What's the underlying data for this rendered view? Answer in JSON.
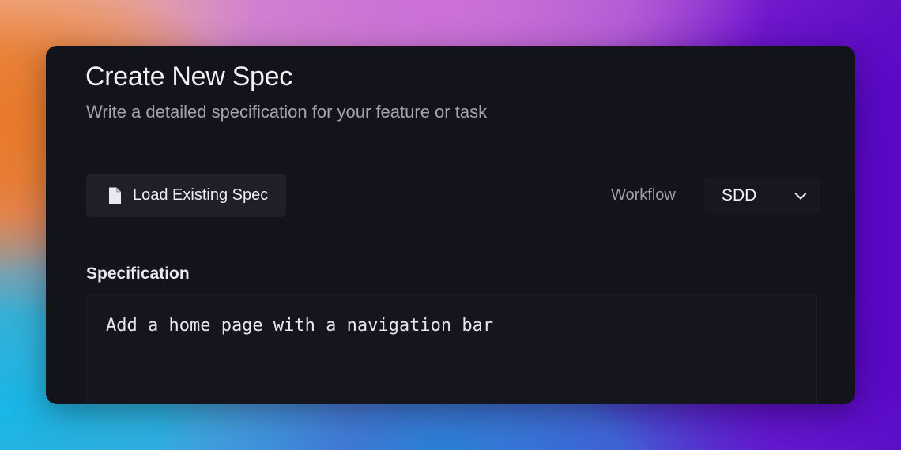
{
  "header": {
    "title": "Create New Spec",
    "subtitle": "Write a detailed specification for your feature or task"
  },
  "toolbar": {
    "load_button_label": "Load Existing Spec",
    "load_button_icon": "file-icon",
    "workflow_label": "Workflow",
    "workflow_selected": "SDD",
    "workflow_icon": "chevron-down-icon"
  },
  "specification": {
    "label": "Specification",
    "value": "Add a home page with a navigation bar"
  },
  "colors": {
    "panel_background": "#13131b",
    "button_background": "#1f1f29",
    "muted_text": "#a3a3b0",
    "primary_text": "#f1f1f5"
  }
}
